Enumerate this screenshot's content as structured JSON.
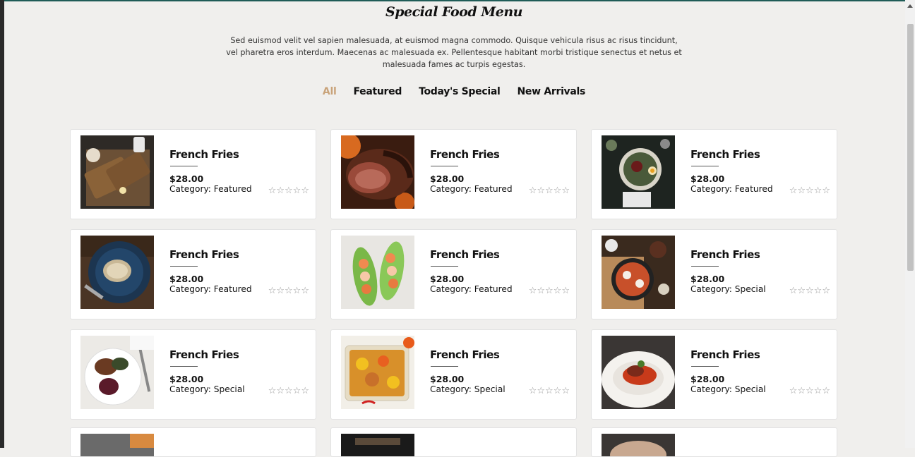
{
  "header": {
    "title": "Special Food Menu",
    "description": "Sed euismod velit vel sapien malesuada, at euismod magna commodo. Quisque vehicula risus ac risus tincidunt, vel pharetra eros interdum. Maecenas ac malesuada ex. Pellentesque habitant morbi tristique senectus et netus et malesuada fames ac turpis egestas."
  },
  "tabs": [
    {
      "label": "All",
      "active": true
    },
    {
      "label": "Featured",
      "active": false
    },
    {
      "label": "Today's Special",
      "active": false
    },
    {
      "label": "New Arrivals",
      "active": false
    }
  ],
  "items": [
    {
      "name": "French Fries",
      "price": "$28.00",
      "category": "Category: Featured",
      "rating": 0,
      "image": "bread-board"
    },
    {
      "name": "French Fries",
      "price": "$28.00",
      "category": "Category: Featured",
      "rating": 0,
      "image": "roast-beef"
    },
    {
      "name": "French Fries",
      "price": "$28.00",
      "category": "Category: Featured",
      "rating": 0,
      "image": "salad-bowl"
    },
    {
      "name": "French Fries",
      "price": "$28.00",
      "category": "Category: Featured",
      "rating": 0,
      "image": "toast-plate"
    },
    {
      "name": "French Fries",
      "price": "$28.00",
      "category": "Category: Featured",
      "rating": 0,
      "image": "lettuce-wraps"
    },
    {
      "name": "French Fries",
      "price": "$28.00",
      "category": "Category: Special",
      "rating": 0,
      "image": "shakshuka-pan"
    },
    {
      "name": "French Fries",
      "price": "$28.00",
      "category": "Category: Special",
      "rating": 0,
      "image": "meat-plate"
    },
    {
      "name": "French Fries",
      "price": "$28.00",
      "category": "Category: Special",
      "rating": 0,
      "image": "roast-chicken-tray"
    },
    {
      "name": "French Fries",
      "price": "$28.00",
      "category": "Category: Special",
      "rating": 0,
      "image": "pasta-bowl"
    }
  ],
  "stars_glyphs": "☆☆☆☆☆",
  "colors": {
    "accent": "#c9a37a",
    "background": "#f0efed",
    "card": "#ffffff"
  }
}
